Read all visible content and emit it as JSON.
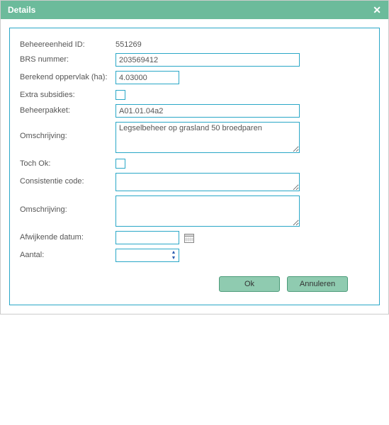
{
  "dialog": {
    "title": "Details"
  },
  "fields": {
    "beheereenheid_id": {
      "label": "Beheereenheid ID:",
      "value": "551269"
    },
    "brs_nummer": {
      "label": "BRS nummer:",
      "value": "203569412"
    },
    "berekend_opp": {
      "label": "Berekend oppervlak (ha):",
      "value": "4.03000"
    },
    "extra_subsidies": {
      "label": "Extra subsidies:",
      "checked": false
    },
    "beheerpakket": {
      "label": "Beheerpakket:",
      "value": "A01.01.04a2"
    },
    "omschrijving1": {
      "label": "Omschrijving:",
      "value": "Legselbeheer op grasland 50 broedparen"
    },
    "toch_ok": {
      "label": "Toch Ok:",
      "checked": false
    },
    "consistentie_code": {
      "label": "Consistentie code:",
      "value": ""
    },
    "omschrijving2": {
      "label": "Omschrijving:",
      "value": ""
    },
    "afwijkende_datum": {
      "label": "Afwijkende datum:",
      "value": ""
    },
    "aantal": {
      "label": "Aantal:",
      "value": ""
    }
  },
  "buttons": {
    "ok": "Ok",
    "cancel": "Annuleren"
  }
}
